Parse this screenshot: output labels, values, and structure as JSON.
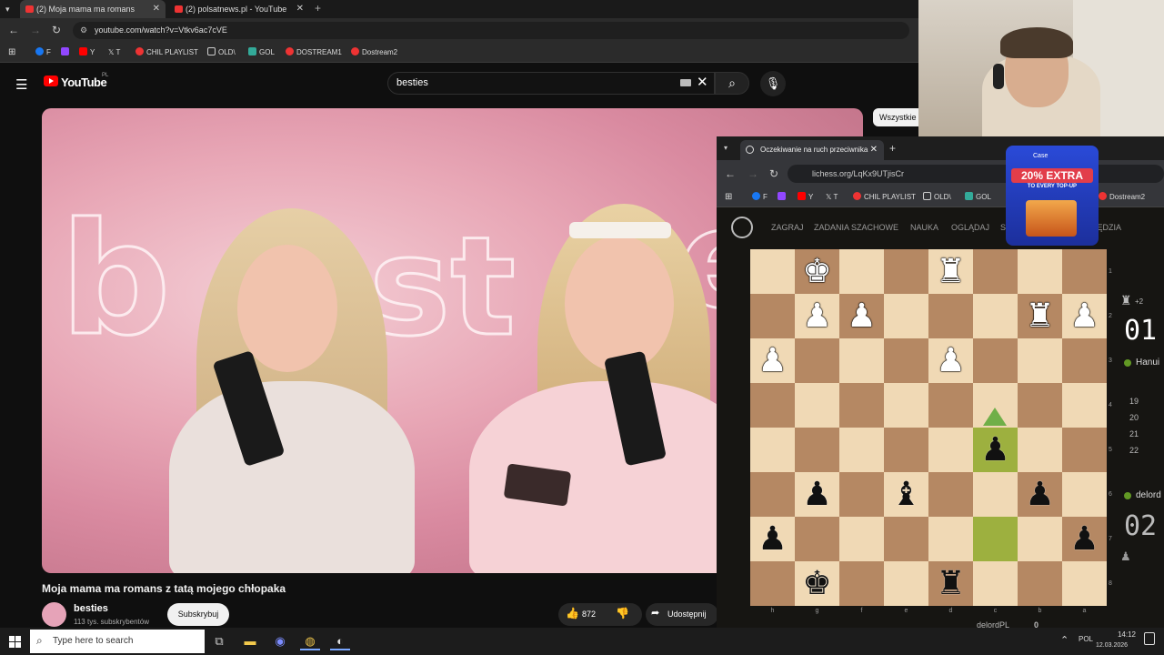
{
  "browser1": {
    "tabs": [
      {
        "label": "(2) Moja mama ma romans"
      },
      {
        "label": "(2) polsatnews.pl - YouTube"
      }
    ],
    "url": "youtube.com/watch?v=Vtkv6ac7cVE",
    "bookmarks": [
      "F",
      "Y",
      "T",
      "CHIL PLAYLIST",
      "OLD\\",
      "GOL",
      "DOSTREAM1",
      "Dostream2"
    ]
  },
  "youtube": {
    "logo_text": "YouTube",
    "region": "PL",
    "search_value": "besties",
    "video": {
      "title": "Moja mama ma romans z tatą mojego chłopaka",
      "channel": "besties",
      "subscribers": "113 tys. subskrybentów",
      "subscribe_label": "Subskrybuj",
      "likes": "872",
      "share_label": "Udostępnij"
    },
    "filter_chip": "Wszystkie"
  },
  "browser2": {
    "tab_label": "Oczekiwanie na ruch przeciwnika",
    "url": "lichess.org/LqKx9UTjisCr",
    "bookmarks": [
      "F",
      "Y",
      "T",
      "CHIL PLAYLIST",
      "OLD\\",
      "GOL",
      "Dostream2"
    ]
  },
  "lichess": {
    "nav": [
      "ZAGRAJ",
      "ZADANIA SZACHOWE",
      "NAUKA",
      "OGLĄDAJ",
      "SPOŁ",
      "NARZĘDZIA"
    ],
    "board": [
      [
        "",
        "wK",
        "",
        "",
        "wR",
        "",
        "",
        ""
      ],
      [
        "",
        "wP",
        "wP",
        "",
        "",
        "",
        "wR",
        "wP"
      ],
      [
        "wP",
        "",
        "",
        "",
        "wP",
        "",
        "",
        ""
      ],
      [
        "",
        "",
        "",
        "",
        "",
        "",
        "",
        ""
      ],
      [
        "",
        "",
        "",
        "",
        "",
        "bP",
        "",
        ""
      ],
      [
        "",
        "bP",
        "",
        "bB",
        "",
        "",
        "bP",
        ""
      ],
      [
        "bP",
        "",
        "",
        "",
        "",
        "",
        "",
        "bP"
      ],
      [
        "",
        "bK",
        "",
        "",
        "bR",
        "",
        "",
        ""
      ]
    ],
    "files": [
      "h",
      "g",
      "f",
      "e",
      "d",
      "c",
      "b",
      "a"
    ],
    "ranks": [
      "1",
      "2",
      "3",
      "4",
      "5",
      "6",
      "7",
      "8"
    ],
    "highlight": [
      [
        4,
        5
      ],
      [
        6,
        5
      ]
    ],
    "material": "+2",
    "clock_top": "01",
    "player_top": "Hanui",
    "move_numbers": [
      "19",
      "20",
      "21",
      "22"
    ],
    "player_bottom": "delord",
    "clock_bottom": "02",
    "bottom_name": "delordPL",
    "bottom_score": "0"
  },
  "ad": {
    "brand": "Case",
    "headline": "20% EXTRA",
    "subline": "TO EVERY TOP-UP"
  },
  "taskbar": {
    "search_placeholder": "Type here to search",
    "lang": "POL",
    "time": "14:12",
    "date": "12.03.2026"
  },
  "colors": {
    "board_light": "#f0d9b5",
    "board_dark": "#b58863",
    "last_move": "#9db03f",
    "youtube_red": "#ff0000",
    "lichess_green": "#629924"
  }
}
